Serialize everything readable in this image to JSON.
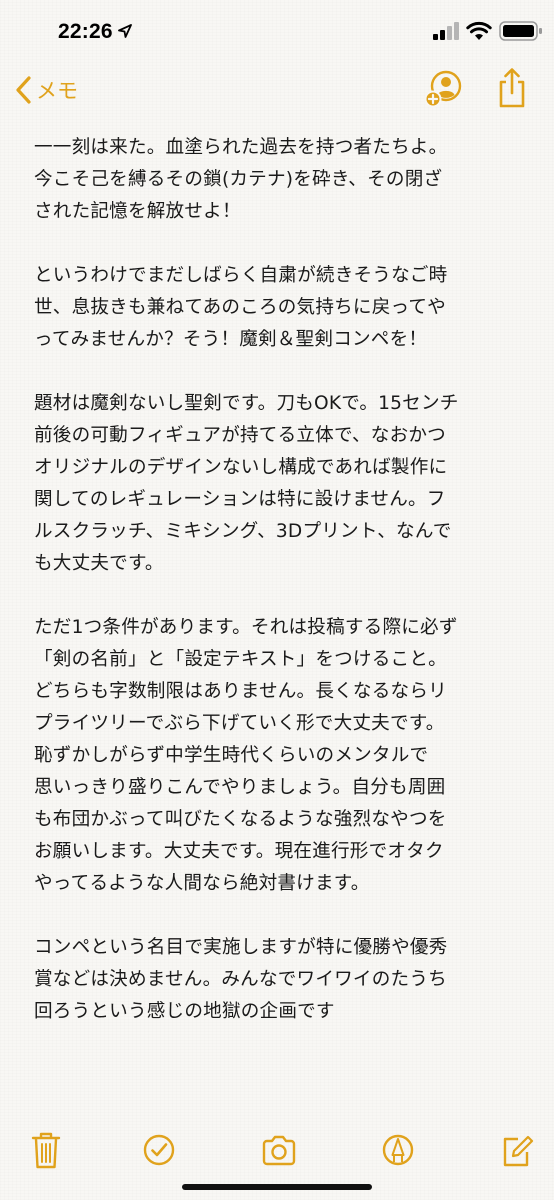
{
  "status_bar": {
    "time": "22:26",
    "icons": [
      "location-arrow-icon",
      "signal-icon",
      "wifi-icon",
      "battery-icon"
    ]
  },
  "nav": {
    "back_label": "メモ",
    "icons": [
      "chevron-left-icon",
      "add-person-icon",
      "share-icon"
    ]
  },
  "colors": {
    "accent": "#e0a21c",
    "text": "#1a1a1a",
    "background": "#f8f7f4"
  },
  "note": {
    "paragraphs": [
      {
        "lines": [
          "一一刻は来た。血塗られた過去を持つ者たちよ。",
          "今こそ己を縛るその鎖(カテナ)を砕き、その閉ざ",
          "された記憶を解放せよ！"
        ]
      },
      {
        "lines": [
          "というわけでまだしばらく自粛が続きそうなご時",
          "世、息抜きも兼ねてあのころの気持ちに戻ってや",
          "ってみませんか？そう！魔剣＆聖剣コンペを！"
        ]
      },
      {
        "lines": [
          "題材は魔剣ないし聖剣です。刀もOKで。15センチ",
          "前後の可動フィギュアが持てる立体で、なおかつ",
          "オリジナルのデザインないし構成であれば製作に",
          "関してのレギュレーションは特に設けません。フ",
          "ルスクラッチ、ミキシング、3Dプリント、なんで",
          "も大丈夫です。"
        ]
      },
      {
        "lines": [
          "ただ1つ条件があります。それは投稿する際に必ず",
          "「剣の名前」と「設定テキスト」をつけること。",
          "どちらも字数制限はありません。長くなるならリ",
          "プライツリーでぶら下げていく形で大丈夫です。",
          "恥ずかしがらず中学生時代くらいのメンタルで",
          "思いっきり盛りこんでやりましょう。自分も周囲",
          "も布団かぶって叫びたくなるような強烈なやつを",
          "お願いします。大丈夫です。現在進行形でオタク",
          "やってるような人間なら絶対書けます。"
        ]
      },
      {
        "lines": [
          "コンペという名目で実施しますが特に優勝や優秀",
          "賞などは決めません。みんなでワイワイのたうち",
          "回ろうという感じの地獄の企画です"
        ]
      }
    ]
  },
  "toolbar": {
    "icons": [
      "trash-icon",
      "checklist-icon",
      "camera-icon",
      "markup-icon",
      "compose-icon"
    ]
  }
}
